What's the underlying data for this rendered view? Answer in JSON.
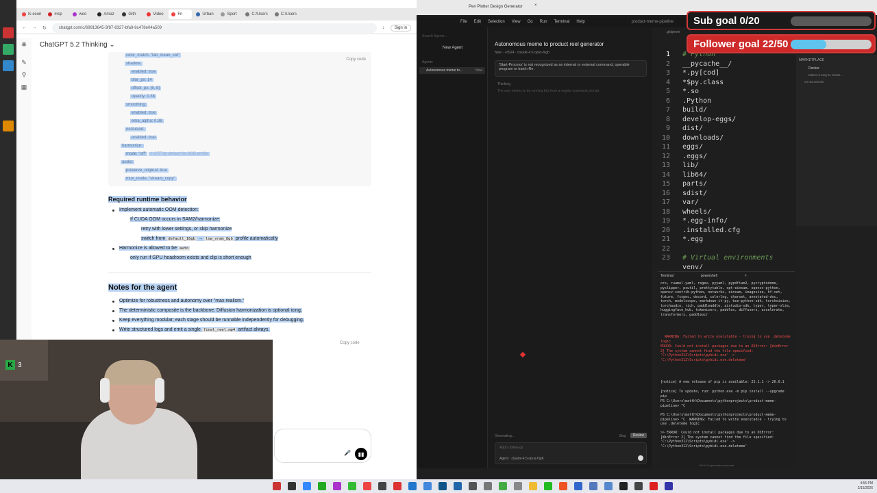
{
  "browser": {
    "tabs": [
      "Is econ",
      "mcp",
      "woo",
      "Amaz",
      "Gith",
      "Video",
      "Fri",
      "Urban",
      "Sport",
      "C:/Users",
      "C:/Users"
    ],
    "url": "chatgpt.com/c/69913645-3f87-8327-bfa9-8c478e04a509",
    "sign_in": "Sign in",
    "model_label": "ChatGPT 5.2 Thinking",
    "copy_code": "Copy code",
    "copy_code_2": "Copy code",
    "code_lines": [
      "color_match: \"lab_mean_std\"",
      "shadow:",
      "enabled: true",
      "blur_px: 14",
      "offset_px: [6, 8]",
      "opacity: 0.38",
      "smoothing:",
      "enabled: true",
      "ema_alpha: 0.38",
      "occlusion:",
      "enabled: true",
      "harmonize:",
      "mode: \"off\"",
      "audio:",
      "preserve_original: true",
      "mux_mode: \"stream_copy\""
    ],
    "code_comment": "# OFF by default for 8GB profile",
    "section1_title": "Required runtime behavior",
    "s1_items": [
      "Implement automatic OOM detection:",
      "If CUDA OOM occurs in SAM2/harmonize:",
      "retry with lower settings, or skip harmonize",
      "switch from",
      "default_16gb",
      "→",
      "low_vram_8gb",
      "profile automatically",
      "Harmonize is allowed to be",
      "auto",
      "only run if GPU headroom exists and clip is short enough"
    ],
    "section2_title": "Notes for the agent",
    "s2_items": [
      "Optimize for robustness and autonomy over \"max realism.\"",
      "The deterministic composite is the backbone. Diffusion harmonization is optional icing.",
      "Keep everything modular; each stage should be runnable independently for debugging.",
      "Write structured logs and emit a single",
      "final_reel.mp4",
      "artifact always."
    ],
    "webcam_badge": "3"
  },
  "cursor": {
    "window_title": "Pen Plotter Design Generator",
    "project": "product-meme-pipeline",
    "menu": [
      "File",
      "Edit",
      "Selection",
      "View",
      "Go",
      "Run",
      "Terminal",
      "Help"
    ],
    "search_agents": "Search Agents...",
    "new_agent": "New Agent",
    "agents_heading": "Agents",
    "agent_item": "Autonomous meme to...",
    "agent_item_status": "Now",
    "agent_title": "Autonomous meme to product reel generator",
    "agent_meta": "Now · +5924 · claude-4.5-opus-high",
    "agent_message": "'Start-Process' is not recognized as an internal or external command, operable program or batch file.",
    "thinking_label": "Thinking",
    "thinking_text": "The user seems to be running this from a regular command prompt",
    "generating": "Generating...",
    "stop": "Stop",
    "review": "Review",
    "input_placeholder": "Add a follow-up",
    "agent_mode": "Agent · claude-4.5-opus-high",
    "editor_tab": ".gitignore",
    "line_numbers": [
      "1",
      "2",
      "3",
      "4",
      "5",
      "6",
      "7",
      "8",
      "9",
      "10",
      "11",
      "12",
      "13",
      "14",
      "15",
      "16",
      "17",
      "18",
      "19",
      "20",
      "21",
      "22",
      "23"
    ],
    "code_lines": [
      "# Python",
      "__pycache__/",
      "*.py[cod]",
      "*$py.class",
      "*.so",
      ".Python",
      "build/",
      "develop-eggs/",
      "dist/",
      "downloads/",
      "eggs/",
      ".eggs/",
      "lib/",
      "lib64/",
      "parts/",
      "sdist/",
      "var/",
      "wheels/",
      "*.egg-info/",
      ".installed.cfg",
      "*.egg",
      "",
      "# Virtual environments"
    ],
    "code_partial": "venv/",
    "marketplace": "MARKETPLACE",
    "ext_name": "Docker",
    "ext_desc": "Makes it easy to create...",
    "ext_pub": "ms-azuretools",
    "terminal_title": "Terminal",
    "terminal_shell": "powershell",
    "terminal_lines": [
      {
        "t": "ors, ruamel.yaml, regex, pyyaml, pypdfium2, pycryptodome, pyclipper, psutil, prettytable, opt-einsum, opencv-python, opencv-contrib-python, networkx, einsum, imagesize, hf-xet, future, fsspec, decord, colorlog, charset, annotated-doc, torch, modelscope, markdown-it-py, bce-python-sdk, torchvision, torchaudio, rich, paddleaddle, aistudio-sdk, typer, typer-slim, huggingface_hub, tokenizers, paddlex, diffusers, accelerate, transformers, paddleocr",
        "c": "n"
      },
      {
        "t": "  WARNING: Failed to write executable - trying to use .deleteme logic",
        "c": "w"
      },
      {
        "t": "ERROR: Could not install packages due to an OSError: [WinError 2] The system cannot find the file specified: 'C:\\Python312\\Scripts\\pybidi.exe' -> 'C:\\Python312\\Scripts\\pybidi.exe.deleteme'",
        "c": "e"
      },
      {
        "t": "",
        "c": "n"
      },
      {
        "t": "[notice] A new release of pip is available: 25.1.1 -> 26.0.1",
        "c": "n"
      },
      {
        "t": "[notice] To update, run: python.exe -m pip install --upgrade pip",
        "c": "n"
      },
      {
        "t": "PS C:\\Users\\matth\\Documents\\pythonprojects\\product-meme-pipeline> ^C",
        "c": "n"
      },
      {
        "t": "PS C:\\Users\\matth\\Documents\\pythonprojects\\product-meme-pipeline> ^C  WARNING: Failed to write executable - trying to use .deleteme logic",
        "c": "n"
      },
      {
        "t": ">> ERROR: Could not install packages due to an OSError: [WinError 2] The system cannot find the file specified: 'C:\\Python312\\Scripts\\pybidi.exe' -> 'C:\\Python312\\Scripts\\pybidi.exe.deleteme'",
        "c": "n"
      }
    ],
    "terminal_footer": "Ctrl+K to generate command"
  },
  "overlays": {
    "sub_goal": "Sub goal 0/20",
    "sub_goal_progress": 0.0,
    "follower_goal": "Follower goal 22/50",
    "follower_goal_progress": 0.44
  },
  "taskbar": {
    "time": "4:55 PM",
    "date": "2/15/2026"
  },
  "colors": {
    "selection": "#b9d3f3",
    "goal_red": "#cf2a2a",
    "goal_fill": "#5ec4ee",
    "terminal_error": "#f14c4c"
  }
}
